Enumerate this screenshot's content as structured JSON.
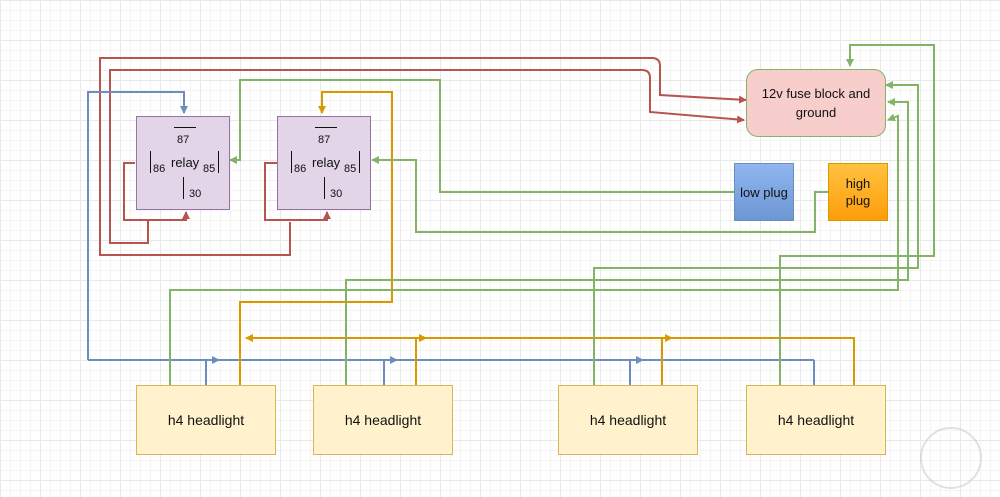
{
  "relays": [
    {
      "title": "relay",
      "pin87": "87",
      "pin86": "86",
      "pin85": "85",
      "pin30": "30"
    },
    {
      "title": "relay",
      "pin87": "87",
      "pin86": "86",
      "pin85": "85",
      "pin30": "30"
    }
  ],
  "fuse_block": {
    "label": "12v fuse block and ground"
  },
  "low_plug": {
    "label": "low plug"
  },
  "high_plug": {
    "label": "high plug"
  },
  "headlights": [
    {
      "label": "h4 headlight"
    },
    {
      "label": "h4 headlight"
    },
    {
      "label": "h4 headlight"
    },
    {
      "label": "h4 headlight"
    }
  ],
  "colors": {
    "red_wire": "#b85450",
    "green_wire": "#82b366",
    "blue_wire": "#6c8ebf",
    "orange_wire": "#d79b00"
  }
}
